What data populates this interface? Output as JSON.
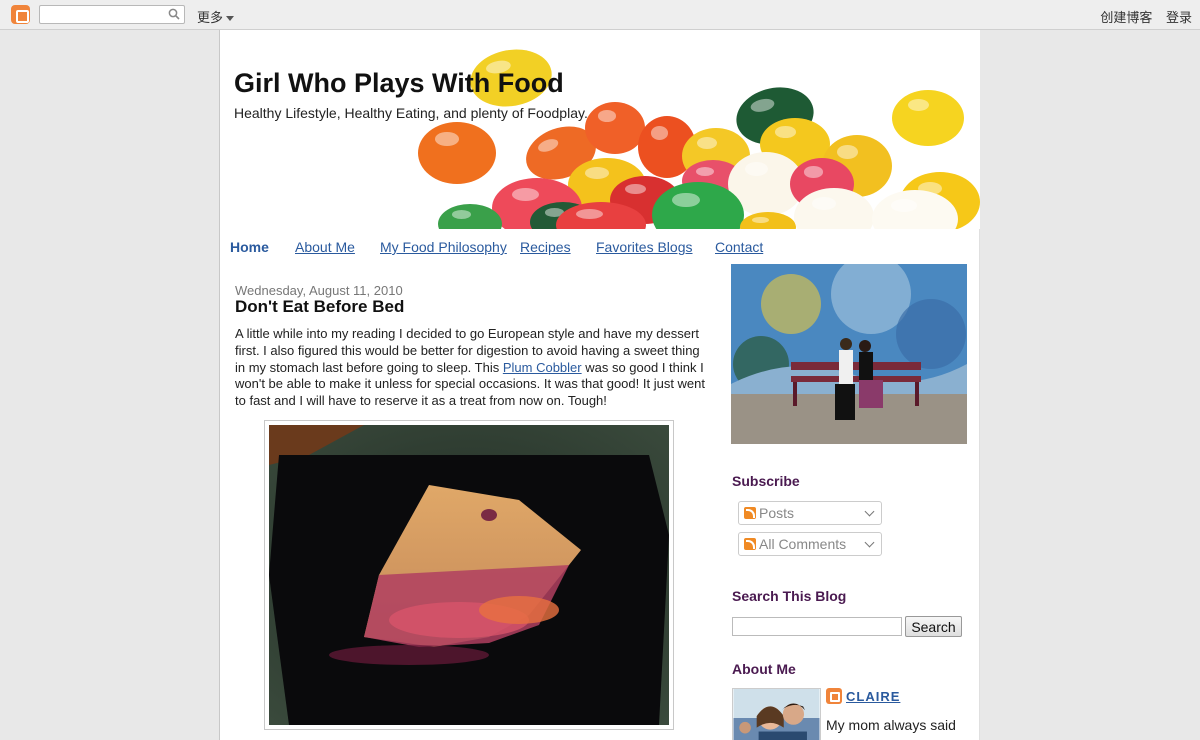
{
  "navbar": {
    "more_label": "更多",
    "create_blog": "创建博客",
    "sign_in": "登录",
    "search_placeholder": ""
  },
  "header": {
    "title": "Girl Who Plays With Food",
    "description": "Healthy Lifestyle, Healthy Eating, and plenty of Foodplay."
  },
  "tabs": [
    "Home",
    "About Me",
    "My Food Philosophy",
    "Recipes",
    "Favorites Blogs",
    "Contact"
  ],
  "post": {
    "date": "Wednesday, August 11, 2010",
    "title": "Don't Eat Before Bed",
    "body_before": "A little while into my reading I decided to go European style and have my dessert first. I also figured this would be better for digestion to avoid having a sweet thing in my stomach last before going to sleep. This ",
    "link_text": "Plum Cobbler",
    "body_after": " was so good I think I won't be able to make it unless for special occasions. It was that good! It just went to fast and I will have to reserve it as a treat from now on. Tough!"
  },
  "sidebar": {
    "subscribe_heading": "Subscribe",
    "feeds": [
      "Posts",
      "All Comments"
    ],
    "search_heading": "Search This Blog",
    "search_button": "Search",
    "about_heading": "About Me",
    "profile_name": "CLAIRE",
    "profile_text": "My mom always said"
  },
  "colors": {
    "link": "#2a5a9e",
    "heading": "#4a1a50",
    "blogger_orange": "#f0843a"
  }
}
